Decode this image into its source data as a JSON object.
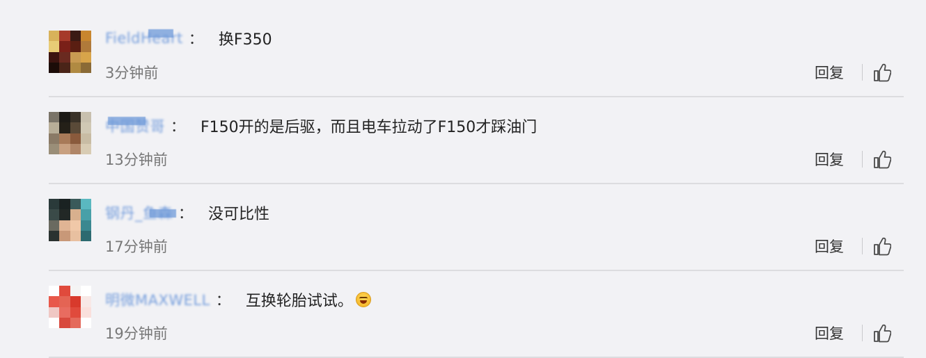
{
  "comments": [
    {
      "author": "FieldHeart",
      "text": "换F350",
      "emoji": "",
      "time": "3分钟前",
      "reply_label": "回复",
      "avatar_icon": "user-avatar-pixelated"
    },
    {
      "author": "中国赞哥",
      "text": "F150开的是后驱，而且电车拉动了F150才踩油门",
      "emoji": "",
      "time": "13分钟前",
      "reply_label": "回复",
      "avatar_icon": "user-avatar-pixelated"
    },
    {
      "author": "钢丹_鱼森",
      "text": "没可比性",
      "emoji": "",
      "time": "17分钟前",
      "reply_label": "回复",
      "avatar_icon": "user-avatar-pixelated"
    },
    {
      "author": "明微MAXWELL",
      "text": "互换轮胎试试。",
      "emoji": "laughing-face-emoji",
      "time": "19分钟前",
      "reply_label": "回复",
      "avatar_icon": "user-avatar-pixelated"
    }
  ],
  "colon": "：",
  "colors": {
    "background": "#f2f2f5",
    "author_link": "#5f8fd8",
    "divider": "#dcdcdf",
    "timestamp": "#777777"
  }
}
